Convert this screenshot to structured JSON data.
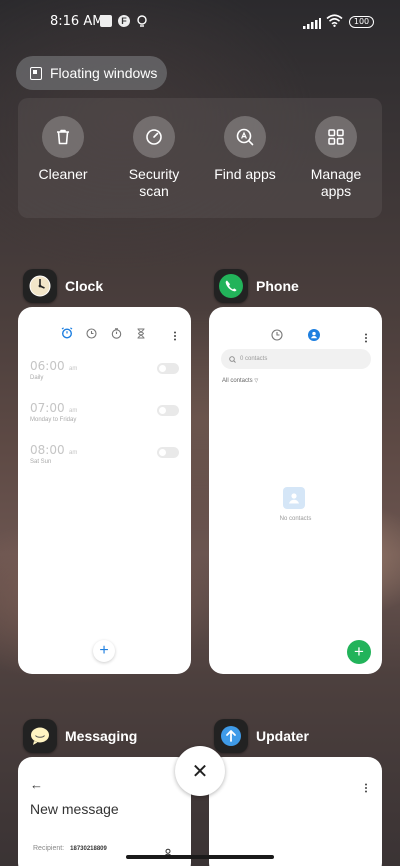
{
  "status_bar": {
    "time": "8:16 AM",
    "battery": "100",
    "notif_f": "F"
  },
  "floating_windows": {
    "label": "Floating windows"
  },
  "quick_actions": [
    {
      "label": "Cleaner",
      "icon": "trash-icon"
    },
    {
      "label": "Security scan",
      "icon": "gauge-icon"
    },
    {
      "label": "Find apps",
      "icon": "search-apps-icon"
    },
    {
      "label": "Manage apps",
      "icon": "grid-icon"
    }
  ],
  "apps": {
    "clock": {
      "name": "Clock",
      "alarms": [
        {
          "time": "06:00",
          "ampm": "am",
          "repeat": "Daily"
        },
        {
          "time": "07:00",
          "ampm": "am",
          "repeat": "Monday to Friday"
        },
        {
          "time": "08:00",
          "ampm": "am",
          "repeat": "Sat Sun"
        }
      ],
      "add_label": "+"
    },
    "phone": {
      "name": "Phone",
      "search_placeholder": "0 contacts",
      "filter_label": "All contacts",
      "empty_label": "No contacts",
      "add_label": "+"
    },
    "messaging": {
      "name": "Messaging",
      "back": "←",
      "title": "New message",
      "recipient_label": "Recipient:",
      "recipient_value": "18730218809"
    },
    "updater": {
      "name": "Updater"
    }
  },
  "close_label": "✕",
  "colors": {
    "clock_accent": "#1e7fe0",
    "phone_accent": "#22b35a",
    "updater_accent": "#3f9be8"
  }
}
